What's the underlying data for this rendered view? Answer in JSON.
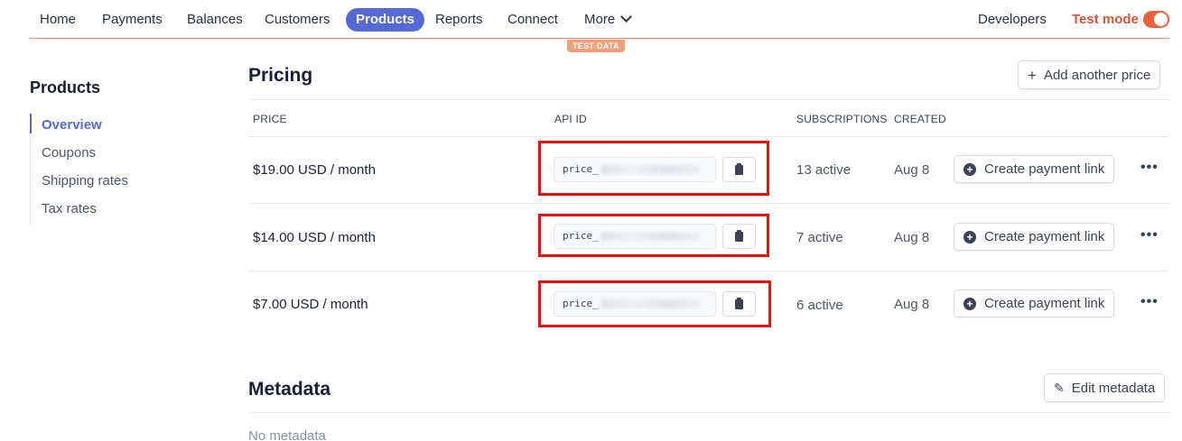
{
  "nav": {
    "items": [
      "Home",
      "Payments",
      "Balances",
      "Customers",
      "Products",
      "Reports",
      "Connect",
      "More"
    ],
    "active": "Products",
    "developers": "Developers",
    "test_mode": "Test mode",
    "test_badge": "TEST DATA"
  },
  "sidebar": {
    "title": "Products",
    "items": [
      "Overview",
      "Coupons",
      "Shipping rates",
      "Tax rates"
    ],
    "active": "Overview"
  },
  "pricing": {
    "title": "Pricing",
    "add_button": "Add another price",
    "columns": [
      "PRICE",
      "API ID",
      "SUBSCRIPTIONS",
      "CREATED"
    ],
    "rows": [
      {
        "price": "$19.00 USD / month",
        "api_id_prefix": "price_",
        "subscriptions": "13 active",
        "created": "Aug 8",
        "action": "Create payment link"
      },
      {
        "price": "$14.00 USD / month",
        "api_id_prefix": "price_",
        "subscriptions": "7 active",
        "created": "Aug 8",
        "action": "Create payment link"
      },
      {
        "price": "$7.00 USD / month",
        "api_id_prefix": "price_",
        "subscriptions": "6 active",
        "created": "Aug 8",
        "action": "Create payment link"
      }
    ]
  },
  "metadata": {
    "title": "Metadata",
    "edit_button": "Edit metadata",
    "empty_text": "No metadata"
  },
  "colors": {
    "accent": "#5469d4",
    "test_mode": "#e5633e",
    "highlight": "#ee1111"
  }
}
